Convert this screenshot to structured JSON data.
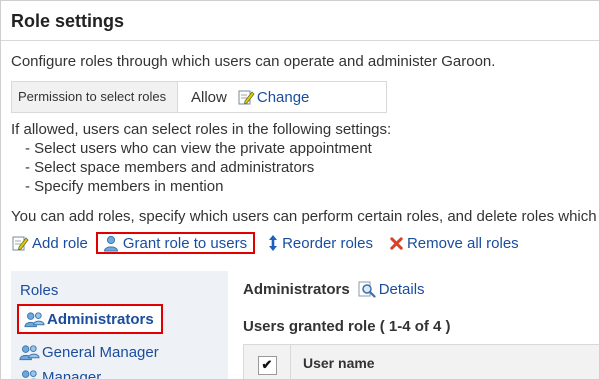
{
  "page": {
    "title": "Role settings",
    "description": "Configure roles through which users can operate and administer Garoon."
  },
  "permission": {
    "label": "Permission to select roles",
    "value": "Allow",
    "change_label": "Change"
  },
  "note": {
    "intro": "If allowed, users can select roles in the following settings:",
    "items": [
      "- Select users who can view the private appointment",
      "- Select space members and administrators",
      "- Specify members in mention"
    ]
  },
  "info": "You can add roles, specify which users can perform certain roles, and delete roles which",
  "toolbar": {
    "add_role": "Add role",
    "grant_role": "Grant role to users",
    "reorder_roles": "Reorder roles",
    "remove_all": "Remove all roles"
  },
  "roles_panel": {
    "heading": "Roles",
    "items": [
      "Administrators",
      "General Manager",
      "Manager"
    ]
  },
  "detail": {
    "role_name": "Administrators",
    "details_label": "Details",
    "granted_label": "Users granted role ( 1-4 of 4 )",
    "column_user_name": "User name",
    "checkbox_mark": "✔"
  },
  "colors": {
    "link": "#1a4d9e",
    "highlight_border": "#e00000",
    "panel_bg": "#eef1f5"
  }
}
